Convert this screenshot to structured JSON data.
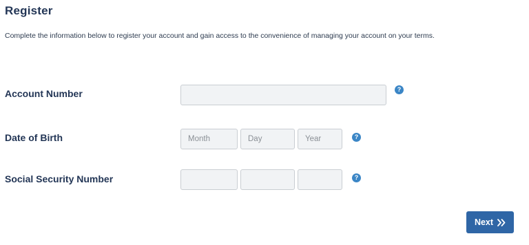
{
  "page": {
    "title": "Register",
    "intro": "Complete the information below to register your account and gain access to the convenience of managing your account on your terms."
  },
  "form": {
    "account_number": {
      "label": "Account Number",
      "value": "",
      "placeholder": ""
    },
    "date_of_birth": {
      "label": "Date of Birth",
      "month_placeholder": "Month",
      "day_placeholder": "Day",
      "year_placeholder": "Year"
    },
    "ssn": {
      "label": "Social Security Number",
      "part1_placeholder": "",
      "part2_placeholder": "",
      "part3_placeholder": ""
    },
    "help_icon": "?"
  },
  "actions": {
    "next_label": "Next",
    "next_icon": "double-chevron-right-icon"
  },
  "colors": {
    "heading": "#233656",
    "input_bg": "#f1f3f5",
    "input_border": "#c9cdd2",
    "help_icon": "#3b86c6",
    "primary_button": "#2f66a6"
  }
}
